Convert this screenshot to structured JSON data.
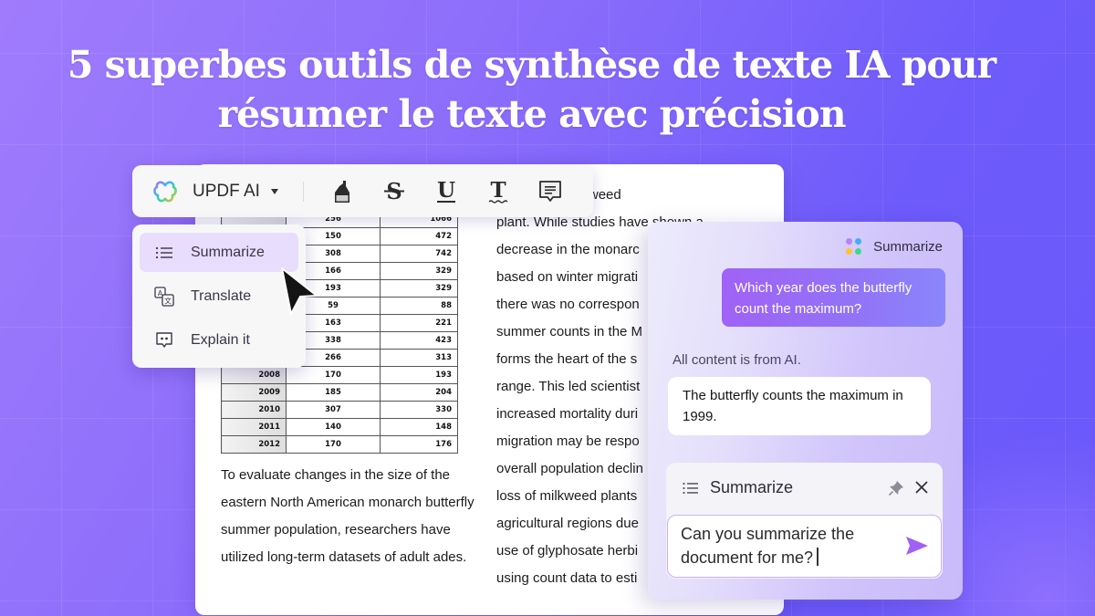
{
  "headline": {
    "line1": "5 superbes outils de synthèse de texte IA pour",
    "line2": "résumer le texte avec précision"
  },
  "toolbar": {
    "logo_icon": "updf-ai-logo-icon",
    "title": "UPDF AI",
    "dropdown_icon": "caret-down-icon",
    "tools": [
      {
        "name": "highlight",
        "icon": "highlighter-icon"
      },
      {
        "name": "strikethrough",
        "icon": "strikethrough-icon"
      },
      {
        "name": "underline",
        "icon": "underline-icon"
      },
      {
        "name": "squiggly",
        "icon": "squiggly-text-icon"
      },
      {
        "name": "comment",
        "icon": "comment-icon"
      }
    ]
  },
  "menu": {
    "items": [
      {
        "label": "Summarize",
        "icon": "list-icon",
        "active": true
      },
      {
        "label": "Translate",
        "icon": "translate-icon",
        "active": false
      },
      {
        "label": "Explain it",
        "icon": "explain-icon",
        "active": false
      }
    ]
  },
  "document": {
    "table_rows": [
      {
        "year": "",
        "a": "256",
        "b": "1066"
      },
      {
        "year": "",
        "a": "150",
        "b": "472"
      },
      {
        "year": "",
        "a": "308",
        "b": "742"
      },
      {
        "year": "",
        "a": "166",
        "b": "329"
      },
      {
        "year": "",
        "a": "193",
        "b": "329"
      },
      {
        "year": "",
        "a": "59",
        "b": "88"
      },
      {
        "year": "",
        "a": "163",
        "b": "221"
      },
      {
        "year": "",
        "a": "338",
        "b": "423"
      },
      {
        "year": "",
        "a": "266",
        "b": "313"
      },
      {
        "year": "2008",
        "a": "170",
        "b": "193"
      },
      {
        "year": "2009",
        "a": "185",
        "b": "204"
      },
      {
        "year": "2010",
        "a": "307",
        "b": "330"
      },
      {
        "year": "2011",
        "a": "140",
        "b": "148"
      },
      {
        "year": "2012",
        "a": "170",
        "b": "176"
      }
    ],
    "left_paragraph": "To evaluate changes in the size of the eastern North American monarch butterfly summer population, researchers have utilized long-term datasets of adult ades.",
    "right_lines": [
      "counts per milkweed",
      "plant. While studies have shown a",
      "decrease in the monarc",
      "based on winter migrati",
      "there was no correspon",
      "summer counts in the M",
      "forms the heart of the s",
      "range. This led scientist",
      "increased mortality duri",
      "migration may be respo",
      "overall population declin",
      "loss of milkweed plants",
      "agricultural regions due",
      "use of glyphosate herbi",
      "using count data to esti"
    ]
  },
  "ai_panel": {
    "header_label": "Summarize",
    "header_icon": "ai-dots-icon",
    "question": "Which year does the butterfly count the maximum?",
    "note": "All content is from AI.",
    "answer": "The butterfly counts the maximum in 1999.",
    "composer": {
      "mode_label": "Summarize",
      "mode_icon": "list-icon",
      "pin_icon": "pin-icon",
      "close_icon": "close-icon",
      "input_value": "Can you summarize the document for me?",
      "send_icon": "send-icon"
    }
  },
  "colors": {
    "accent": "#9b5ef5",
    "menu_active": "#e9ddfd",
    "background_start": "#a07cfc",
    "background_end": "#6a58fb"
  }
}
